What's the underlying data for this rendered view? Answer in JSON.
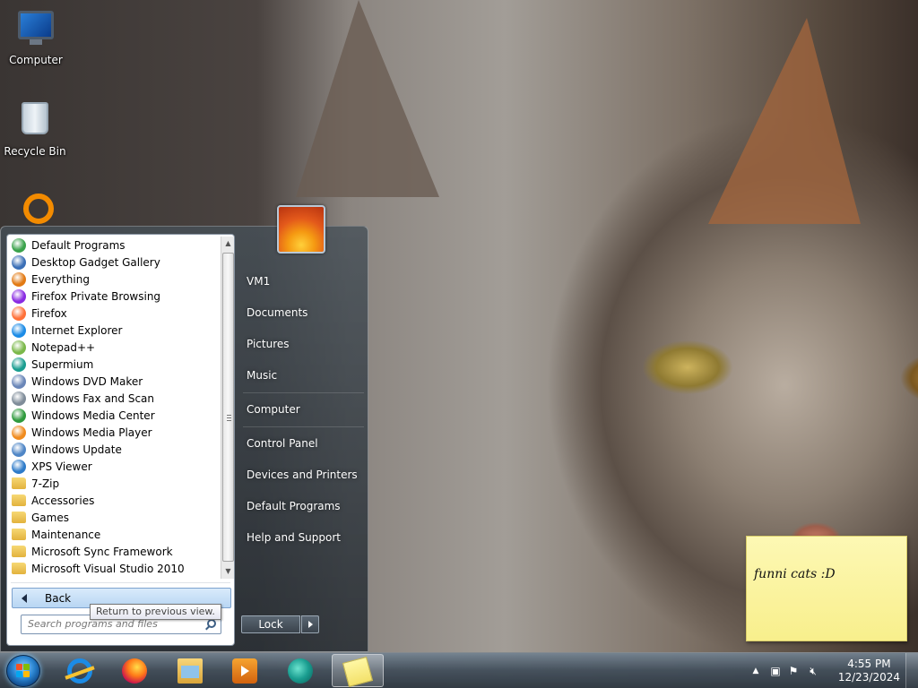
{
  "desktop": {
    "icons": [
      {
        "label": "Computer",
        "icon": "computer-icon"
      },
      {
        "label": "Recycle Bin",
        "icon": "recycle-bin-icon"
      }
    ],
    "sticky_note_text": "funni cats :D"
  },
  "start_menu": {
    "programs": [
      {
        "label": "Default Programs",
        "icon": "default-programs-icon",
        "color": "#3aa24b"
      },
      {
        "label": "Desktop Gadget Gallery",
        "icon": "gadget-icon",
        "color": "#3b6fb6"
      },
      {
        "label": "Everything",
        "icon": "magnifier-icon",
        "color": "#e27a14"
      },
      {
        "label": "Firefox Private Browsing",
        "icon": "firefox-private-icon",
        "color": "#8a2be2"
      },
      {
        "label": "Firefox",
        "icon": "firefox-icon",
        "color": "#ff7139"
      },
      {
        "label": "Internet Explorer",
        "icon": "internet-explorer-icon",
        "color": "#1b8be6"
      },
      {
        "label": "Notepad++",
        "icon": "notepadpp-icon",
        "color": "#7bb84a"
      },
      {
        "label": "Supermium",
        "icon": "supermium-icon",
        "color": "#1a9d90"
      },
      {
        "label": "Windows DVD Maker",
        "icon": "dvd-maker-icon",
        "color": "#6a86b8"
      },
      {
        "label": "Windows Fax and Scan",
        "icon": "fax-icon",
        "color": "#7f8c99"
      },
      {
        "label": "Windows Media Center",
        "icon": "media-center-icon",
        "color": "#2f9a3d"
      },
      {
        "label": "Windows Media Player",
        "icon": "media-player-icon",
        "color": "#f08b1e"
      },
      {
        "label": "Windows Update",
        "icon": "windows-update-icon",
        "color": "#4f86c6"
      },
      {
        "label": "XPS Viewer",
        "icon": "xps-viewer-icon",
        "color": "#2e7bc9"
      },
      {
        "label": "7-Zip",
        "icon": "folder-icon",
        "color": "folder"
      },
      {
        "label": "Accessories",
        "icon": "folder-icon",
        "color": "folder"
      },
      {
        "label": "Games",
        "icon": "folder-icon",
        "color": "folder"
      },
      {
        "label": "Maintenance",
        "icon": "folder-icon",
        "color": "folder"
      },
      {
        "label": "Microsoft Sync Framework",
        "icon": "folder-icon",
        "color": "folder"
      },
      {
        "label": "Microsoft Visual Studio 2010",
        "icon": "folder-icon",
        "color": "folder"
      }
    ],
    "back_label": "Back",
    "back_tooltip": "Return to previous view.",
    "search_placeholder": "Search programs and files",
    "right_items": [
      {
        "label": "VM1"
      },
      {
        "label": "Documents"
      },
      {
        "label": "Pictures"
      },
      {
        "label": "Music"
      },
      {
        "label": "Computer"
      },
      {
        "label": "Control Panel"
      },
      {
        "label": "Devices and Printers"
      },
      {
        "label": "Default Programs"
      },
      {
        "label": "Help and Support"
      }
    ],
    "lock_label": "Lock"
  },
  "taskbar": {
    "pinned": [
      {
        "name": "internet-explorer-icon"
      },
      {
        "name": "firefox-icon"
      },
      {
        "name": "windows-explorer-icon"
      },
      {
        "name": "windows-media-player-icon"
      },
      {
        "name": "supermium-icon"
      },
      {
        "name": "sticky-notes-icon",
        "active": true
      }
    ],
    "tray": {
      "time": "4:55 PM",
      "date": "12/23/2024",
      "icons": [
        "show-hidden-icons-arrow",
        "network-icon",
        "action-center-flag-icon",
        "volume-muted-icon"
      ]
    }
  }
}
